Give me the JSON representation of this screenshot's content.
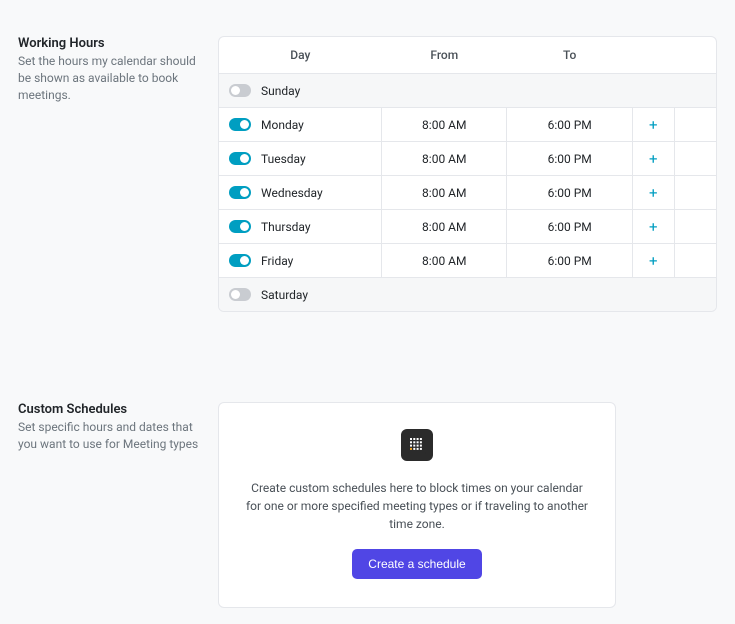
{
  "working_hours": {
    "title": "Working Hours",
    "desc": "Set the hours my calendar should be shown as available to book meetings.",
    "headers": {
      "day": "Day",
      "from": "From",
      "to": "To"
    },
    "days": [
      {
        "name": "Sunday",
        "enabled": false,
        "from": "",
        "to": ""
      },
      {
        "name": "Monday",
        "enabled": true,
        "from": "8:00 AM",
        "to": "6:00 PM"
      },
      {
        "name": "Tuesday",
        "enabled": true,
        "from": "8:00 AM",
        "to": "6:00 PM"
      },
      {
        "name": "Wednesday",
        "enabled": true,
        "from": "8:00 AM",
        "to": "6:00 PM"
      },
      {
        "name": "Thursday",
        "enabled": true,
        "from": "8:00 AM",
        "to": "6:00 PM"
      },
      {
        "name": "Friday",
        "enabled": true,
        "from": "8:00 AM",
        "to": "6:00 PM"
      },
      {
        "name": "Saturday",
        "enabled": false,
        "from": "",
        "to": ""
      }
    ]
  },
  "custom_schedules": {
    "title": "Custom Schedules",
    "desc": "Set specific hours and dates that you want to use for Meeting types",
    "card_desc": "Create custom schedules here to block times on your calendar for one or more specified meeting types or if traveling to another time zone.",
    "button": "Create a schedule"
  }
}
